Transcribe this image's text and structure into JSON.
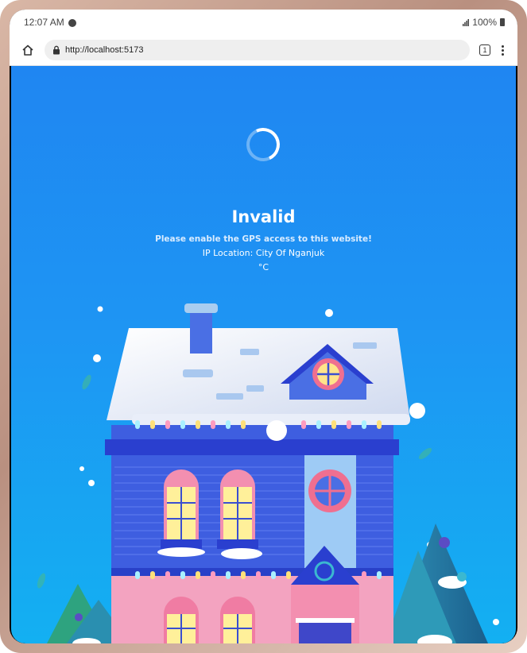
{
  "status_bar": {
    "time": "12:07 AM",
    "battery": "100%"
  },
  "browser": {
    "url": "http://localhost:5173",
    "tab_count": "1"
  },
  "page": {
    "title": "Invalid",
    "message": "Please enable the GPS access to this website!",
    "ip_location": "IP Location: City Of Nganjuk",
    "temperature": "°C"
  },
  "colors": {
    "background_top": "#1f86f2",
    "background_bottom": "#13b0f2",
    "house_blue": "#3f63e0",
    "house_pink": "#f49ab7",
    "roof": "#e7ecf7"
  }
}
